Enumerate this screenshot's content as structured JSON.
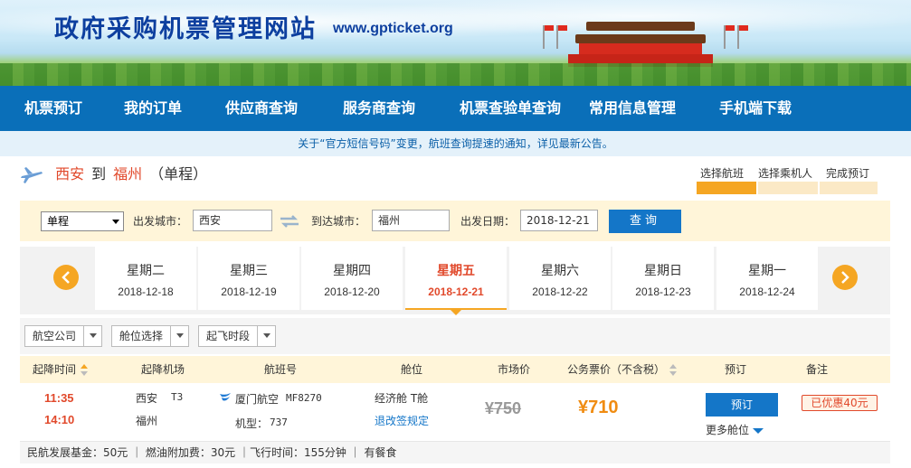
{
  "header": {
    "site_title": "政府采购机票管理网站",
    "site_url": "www.gpticket.org"
  },
  "nav": {
    "items": [
      "机票预订",
      "我的订单",
      "供应商查询",
      "服务商查询",
      "机票查验单查询",
      "常用信息管理",
      "手机端下载"
    ]
  },
  "notice": "关于“官方短信号码”变更，航班查询提速的通知，详见最新公告。",
  "route": {
    "from": "西安",
    "to_word": "到",
    "to": "福州",
    "trip_type": "（单程）"
  },
  "steps": [
    "选择航班",
    "选择乘机人",
    "完成预订"
  ],
  "search": {
    "trip_select": "单程",
    "from_label": "出发城市：",
    "from_value": "西安",
    "to_label": "到达城市：",
    "to_value": "福州",
    "date_label": "出发日期：",
    "date_value": "2018-12-21",
    "query_button": "查询"
  },
  "days": [
    {
      "weekday": "星期二",
      "date": "2018-12-18"
    },
    {
      "weekday": "星期三",
      "date": "2018-12-19"
    },
    {
      "weekday": "星期四",
      "date": "2018-12-20"
    },
    {
      "weekday": "星期五",
      "date": "2018-12-21"
    },
    {
      "weekday": "星期六",
      "date": "2018-12-22"
    },
    {
      "weekday": "星期日",
      "date": "2018-12-23"
    },
    {
      "weekday": "星期一",
      "date": "2018-12-24"
    }
  ],
  "active_day": 3,
  "filters": [
    "航空公司",
    "舱位选择",
    "起飞时段"
  ],
  "table_headers": {
    "time": "起降时间",
    "airport": "起降机场",
    "flight_no": "航班号",
    "cabin": "舱位",
    "market_price": "市场价",
    "gov_price": "公务票价（不含税）",
    "book": "预订",
    "remark": "备注"
  },
  "flight": {
    "dep_time": "11:35",
    "arr_time": "14:10",
    "dep_airport": "西安",
    "dep_terminal": "T3",
    "arr_airport": "福州",
    "airline": "厦门航空",
    "flight_no": "MF8270",
    "aircraft_label": "机型：",
    "aircraft": "737",
    "cabin": "经济舱 T舱",
    "rules_link": "退改签规定",
    "market_price": "¥750",
    "gov_price": "¥710",
    "book_button": "预订",
    "more_cabins": "更多舱位",
    "discount": "已优惠40元"
  },
  "info": "民航发展基金：50元 ｜ 燃油附加费：30元 ｜飞行时间：155分钟 ｜ 有餐食",
  "colors": {
    "nav_blue": "#0a6fb9",
    "accent_orange": "#f5a623",
    "price_orange": "#f08c12",
    "city_red": "#e1492b",
    "button_blue": "#1476c8"
  }
}
